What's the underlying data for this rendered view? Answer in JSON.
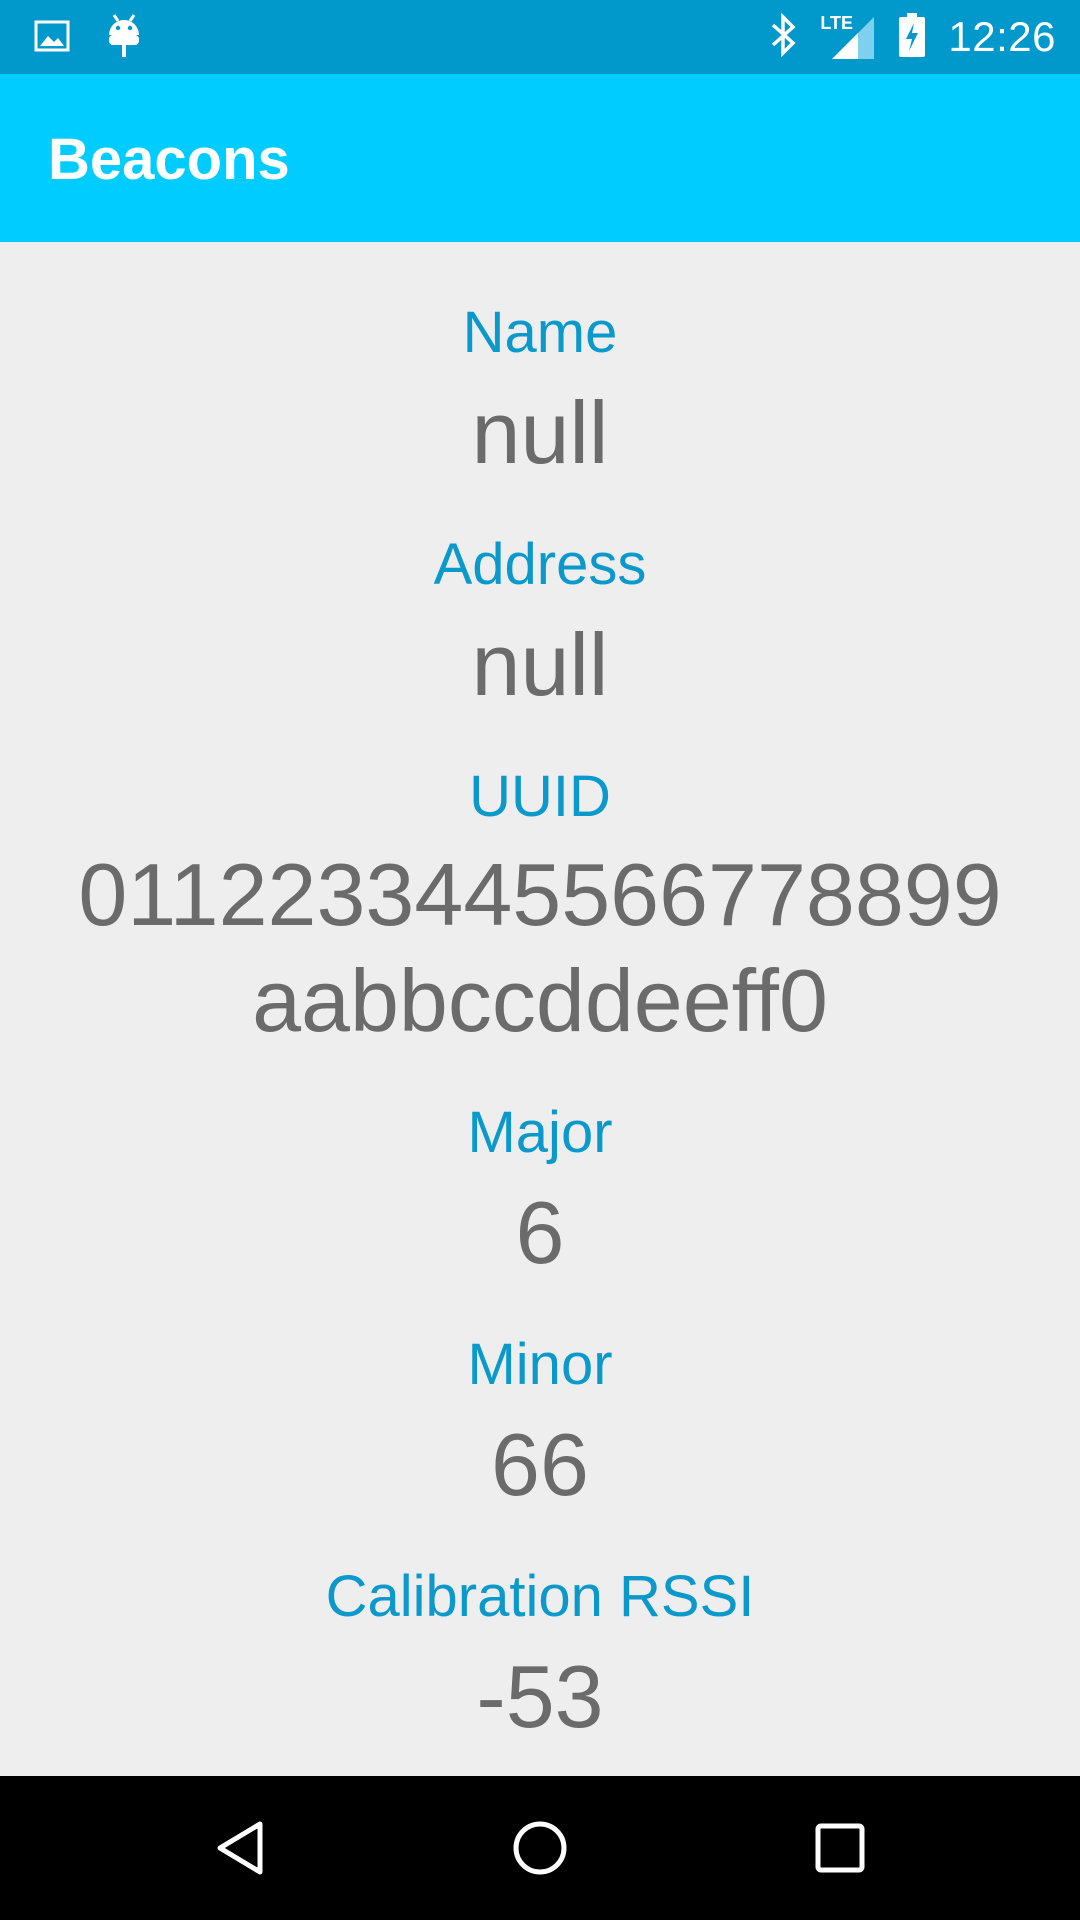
{
  "status_bar": {
    "time": "12:26",
    "left_icons": [
      "image-icon",
      "android-icon"
    ],
    "right_icons": [
      "bluetooth-icon",
      "lte-signal-icon",
      "battery-charging-icon"
    ],
    "network_label": "LTE",
    "background_color": "#0199cc"
  },
  "app_bar": {
    "title": "Beacons",
    "background_color": "#01ccff"
  },
  "fields": [
    {
      "label": "Name",
      "value": "null"
    },
    {
      "label": "Address",
      "value": "null"
    },
    {
      "label": "UUID",
      "value_line1": "0112233445566778899",
      "value_line2": "aabbccddeeff0"
    },
    {
      "label": "Major",
      "value": "6"
    },
    {
      "label": "Minor",
      "value": "66"
    },
    {
      "label": "Calibration RSSI",
      "value": "-53"
    }
  ],
  "colors": {
    "label": "#0b99cc",
    "value": "#6b6b6b",
    "background": "#eeeeee"
  },
  "nav_bar": {
    "buttons": [
      "back-icon",
      "home-icon",
      "recents-icon"
    ]
  }
}
